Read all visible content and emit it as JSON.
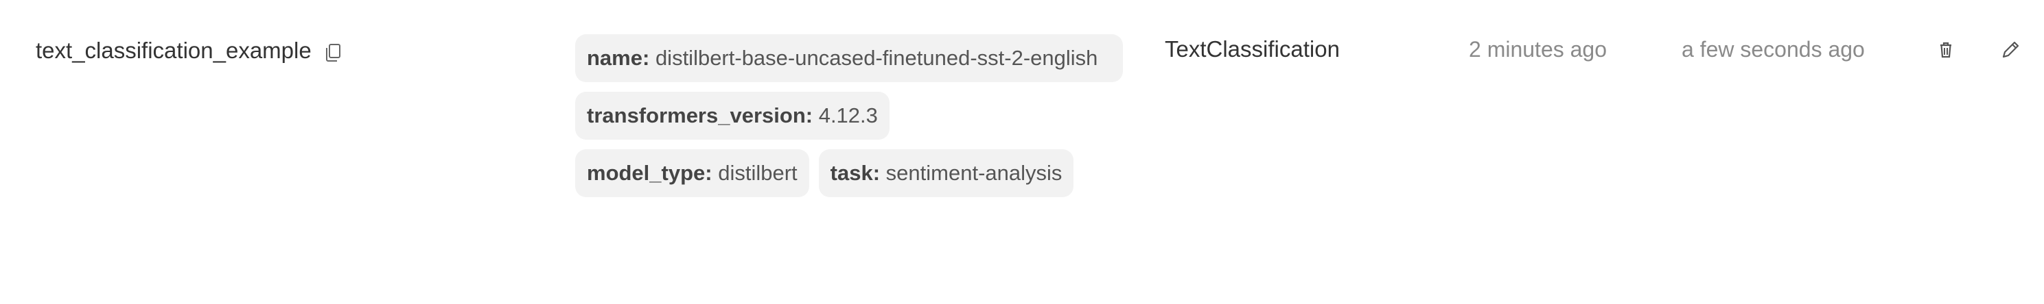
{
  "model": {
    "name": "text_classification_example",
    "tags_row1": [
      {
        "key": "name:",
        "value": "distilbert-base-uncased-finetuned-sst-2-english"
      }
    ],
    "tags_row2": [
      {
        "key": "transformers_version:",
        "value": "4.12.3"
      }
    ],
    "tags_row3": [
      {
        "key": "model_type:",
        "value": "distilbert"
      },
      {
        "key": "task:",
        "value": "sentiment-analysis"
      }
    ],
    "flavor": "TextClassification",
    "created": "2 minutes ago",
    "updated": "a few seconds ago"
  },
  "icons": {
    "copy": "copy-icon",
    "delete": "trash-icon",
    "edit": "pencil-icon"
  },
  "colors": {
    "tag_background": "#f2f2f2",
    "muted_text": "#8a8a8a"
  }
}
